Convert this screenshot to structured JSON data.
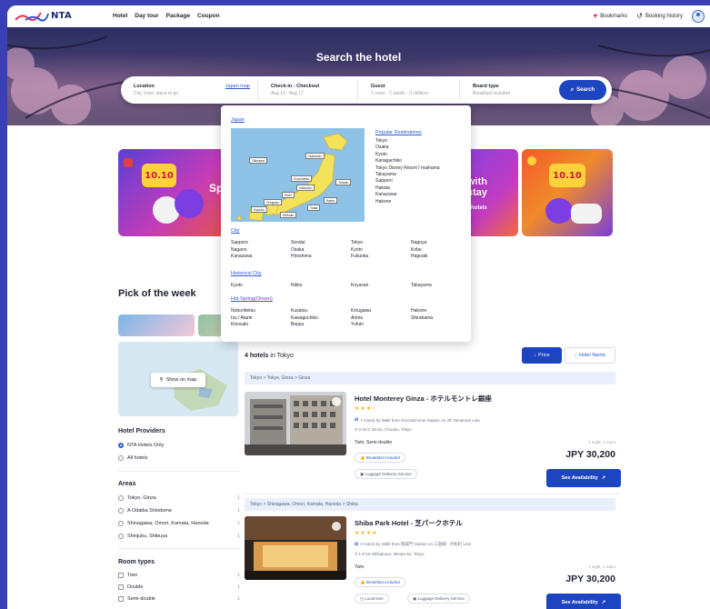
{
  "nav": {
    "logo_text": "NTA",
    "links": [
      "Hotel",
      "Day tour",
      "Package",
      "Coupon"
    ],
    "bookmarks": "Bookmarks",
    "booking_history": "Booking history"
  },
  "hero": {
    "title": "Search the hotel",
    "location_label": "Location",
    "location_placeholder": "City, hotel, place to go",
    "japan_map_link": "Japan map",
    "dates_label": "Check-in - Checkout",
    "dates_value": "Aug 15 - Aug 17",
    "guest_label": "Guest",
    "guest_value": "1 room · 2 adults · 0 children",
    "board_label": "Board type",
    "board_value": "Breakfast included",
    "search_button": "Search"
  },
  "dropdown": {
    "japan_link": "Japan",
    "map_labels": [
      "Hokkaido",
      "Tohoku",
      "Hokuriku",
      "Kanto",
      "Tokai",
      "Kinki",
      "Chugoku",
      "Shikoku",
      "Kyushu",
      "Okinawa",
      "Koshinetsu"
    ],
    "popular_title": "Popular Destinations",
    "popular": [
      "Tokyo",
      "Osaka",
      "Kyoto",
      "Kanagachiko",
      "Tokyo Disney Resort / maihama",
      "Takayama",
      "Sapporo",
      "Hakata",
      "Kanazawa",
      "Hakone"
    ],
    "city_title": "City",
    "cities": [
      "Sapporo",
      "Sendai",
      "Tokyo",
      "Nagoya",
      "Nagano",
      "Osaka",
      "Kyoto",
      "Kobe",
      "Kanazawa",
      "Hiroshima",
      "Fukuoka",
      "Hagoaki"
    ],
    "historical_title": "Historical City",
    "historical": [
      "Kyoto",
      "Nikko",
      "Koyasan",
      "Takayama"
    ],
    "hotspring_title": "Hot Spring(Onsen)",
    "hotsprings": [
      "Noboribetsu",
      "Kusatsu",
      "Kinugawa",
      "Hakone",
      "Izu / Atami",
      "Kawaguchiko",
      "Arima",
      "Shirahama",
      "Kinosaki",
      "Beppu",
      "Yufuin"
    ]
  },
  "banners": {
    "badge": "10.10"
  },
  "pick_title": "Pick of the week",
  "sidebar": {
    "show_on_map": "Show on map",
    "providers_title": "Hotel Providers",
    "providers": [
      {
        "label": "NTA Hotels Only",
        "selected": true
      },
      {
        "label": "All hotels",
        "selected": false
      }
    ],
    "areas_title": "Areas",
    "areas": [
      {
        "label": "Tokyo, Ginza",
        "count": "1"
      },
      {
        "label": "A Odaiba Shiodome",
        "count": "1"
      },
      {
        "label": "Shinagawa, Omori, Kamata, Haneda",
        "count": "1"
      },
      {
        "label": "Shinjuku, Shibuya",
        "count": "1"
      }
    ],
    "room_title": "Room types",
    "rooms": [
      {
        "label": "Twin",
        "count": "1"
      },
      {
        "label": "Double",
        "count": "1"
      },
      {
        "label": "Semi-double",
        "count": "1"
      }
    ]
  },
  "results": {
    "count_bold": "4 hotels",
    "count_rest": " in Tokyo",
    "sort_price": "Price",
    "sort_name": "Hotel Name",
    "hotels": [
      {
        "crumb": "Tokyo > Tokyo, Ginza > Ginza",
        "name": "Hotel Monterey Ginza - ホテルモントレ銀座",
        "stars": "★★★☆",
        "access": "7 min(s) by Walk from Ginzaitchome Station on JR Yamanote Line",
        "address": "2-10-2 Ginza, Chuoku, Tokyo",
        "room": "Twin, Semi-double",
        "breakfast": "Breakfast included",
        "luggage": "Luggage Delivery Service",
        "per_room": "1 night, 1 room",
        "price": "JPY 30,200",
        "cta": "See Availability"
      },
      {
        "crumb": "Tokyo > Shinagawa, Omori, Kamata, Haneda > Shiba",
        "name": "Shiba Park Hotel - 芝パークホテル",
        "stars": "★★★★",
        "access": "3 min(s) by Walk from 御成門 Station on 三田線 - 浜松町 Line",
        "address": "1-5-10 Shibakoen, Minato-ku, Tokyo",
        "room": "Twin",
        "breakfast": "Breakfast included",
        "local": "Local time",
        "luggage": "Luggage Delivery Service",
        "per_room": "1 night, 1 room",
        "price": "JPY 30,200",
        "cta": "See Availability"
      }
    ]
  }
}
